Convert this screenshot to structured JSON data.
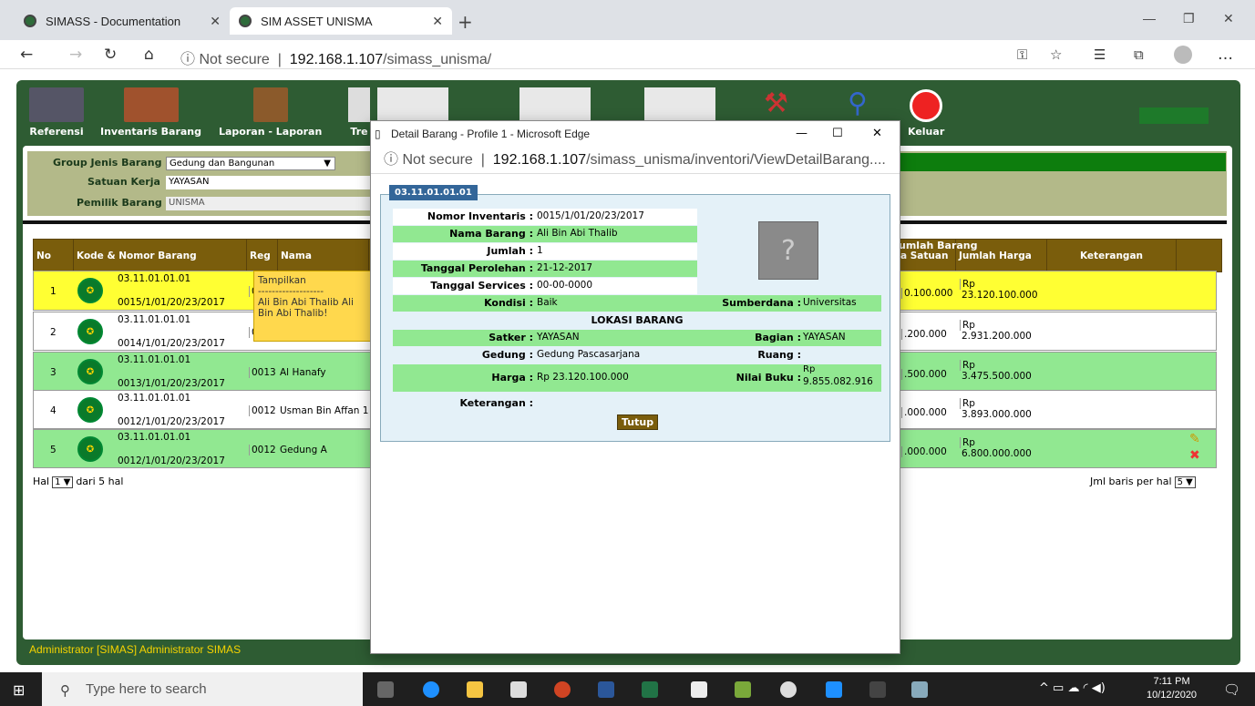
{
  "browser": {
    "tabs": [
      {
        "title": "SIMASS - Documentation"
      },
      {
        "title": "SIM ASSET UNISMA"
      }
    ],
    "address": {
      "security": "Not secure",
      "host": "192.168.1.107",
      "path": "/simass_unisma/"
    }
  },
  "menu": [
    "Referensi",
    "Inventaris Barang",
    "Laporan - Laporan",
    "Tre",
    "Keluar"
  ],
  "filter": {
    "group_label": "Group Jenis Barang",
    "group_value": "Gedung dan Bangunan",
    "satuan_label": "Satuan Kerja",
    "satuan_value": "YAYASAN",
    "pemilik_label": "Pemilik Barang",
    "pemilik_value": "UNISMA"
  },
  "table": {
    "headers": {
      "no": "No",
      "kode": "Kode & Nomor Barang",
      "reg": "Reg",
      "nama": "Nama",
      "jumlah": "umlah Barang",
      "satuan": "a Satuan",
      "harga": "Jumlah Harga",
      "ket": "Keterangan"
    },
    "rows": [
      {
        "no": "1",
        "kode": "03.11.01.01.01",
        "nomor": "0015/1/01/20/23/2017",
        "reg": "0",
        "nama": "",
        "satuan": "0.100.000",
        "harga": "Rp 23.120.100.000"
      },
      {
        "no": "2",
        "kode": "03.11.01.01.01",
        "nomor": "0014/1/01/20/23/2017",
        "reg": "0",
        "nama": "",
        "satuan": ".200.000",
        "harga": "Rp 2.931.200.000"
      },
      {
        "no": "3",
        "kode": "03.11.01.01.01",
        "nomor": "0013/1/01/20/23/2017",
        "reg": "0013",
        "nama": "Al Hanafy",
        "satuan": ".500.000",
        "harga": "Rp 3.475.500.000"
      },
      {
        "no": "4",
        "kode": "03.11.01.01.01",
        "nomor": "0012/1/01/20/23/2017",
        "reg": "0012",
        "nama": "Usman Bin Affan 1",
        "satuan": ".000.000",
        "harga": "Rp 3.893.000.000"
      },
      {
        "no": "5",
        "kode": "03.11.01.01.01",
        "nomor": "0012/1/01/20/23/2017",
        "reg": "0012",
        "nama": "Gedung A",
        "satuan": ".000.000",
        "harga": "Rp 6.800.000.000"
      }
    ]
  },
  "tooltip": {
    "line1": "Tampilkan",
    "line2": "-------------------",
    "line3": "Ali Bin Abi Thalib Ali Bin Abi Thalib!"
  },
  "pager": {
    "hal": "Hal",
    "page": "1",
    "dari": "dari 5 hal",
    "jml": "Jml baris per hal",
    "per": "5"
  },
  "status": "Administrator [SIMAS] Administrator SIMAS",
  "popup": {
    "title": "Detail Barang - Profile 1 - Microsoft Edge",
    "security": "Not secure",
    "host": "192.168.1.107",
    "path": "/simass_unisma/inventori/ViewDetailBarang....",
    "tab": "03.11.01.01.01",
    "fields": {
      "nomor_inventaris": "0015/1/01/20/23/2017",
      "nama_barang": "Ali Bin Abi Thalib",
      "jumlah": "1",
      "tanggal_perolehan": "21-12-2017",
      "tanggal_services": "00-00-0000",
      "kondisi": "Baik",
      "sumberdana": "Universitas",
      "satker": "YAYASAN",
      "bagian": "YAYASAN",
      "gedung": "Gedung Pascasarjana",
      "ruang": "",
      "harga": "Rp 23.120.100.000",
      "nilai_buku": "Rp 9.855.082.916",
      "keterangan": ""
    },
    "labels": {
      "nomor_inventaris": "Nomor Inventaris :",
      "nama_barang": "Nama Barang :",
      "jumlah": "Jumlah :",
      "tanggal_perolehan": "Tanggal Perolehan :",
      "tanggal_services": "Tanggal Services :",
      "kondisi": "Kondisi :",
      "sumberdana": "Sumberdana :",
      "lokasi": "LOKASI BARANG",
      "satker": "Satker :",
      "bagian": "Bagian :",
      "gedung": "Gedung :",
      "ruang": "Ruang :",
      "harga": "Harga :",
      "nilai_buku": "Nilai Buku :",
      "keterangan": "Keterangan :"
    },
    "close_button": "Tutup"
  },
  "taskbar": {
    "search": "Type here to search",
    "time": "7:11 PM",
    "date": "10/12/2020"
  }
}
